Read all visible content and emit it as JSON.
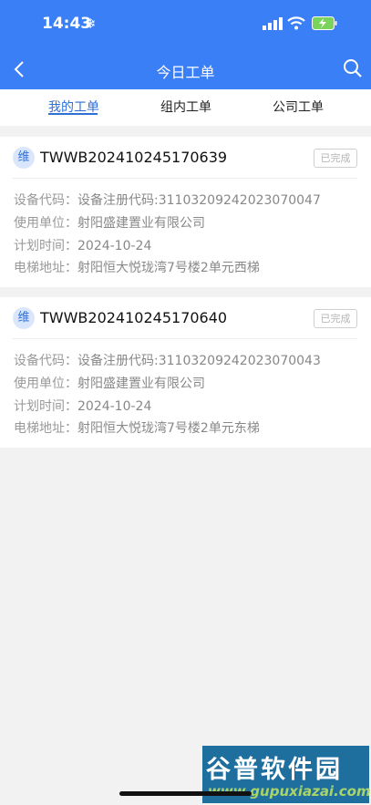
{
  "status_bar": {
    "time": "14:43",
    "weather_icon": "snowflake-icon"
  },
  "nav": {
    "title": "今日工单"
  },
  "tabs": [
    {
      "label": "我的工单",
      "active": true
    },
    {
      "label": "组内工单",
      "active": false
    },
    {
      "label": "公司工单",
      "active": false
    }
  ],
  "orders": [
    {
      "badge": "维",
      "number": "TWWB202410245170639",
      "status": "已完成",
      "fields": [
        {
          "label": "设备代码：",
          "value": "设备注册代码:31103209242023070047"
        },
        {
          "label": "使用单位：",
          "value": "射阳盛建置业有限公司"
        },
        {
          "label": "计划时间：",
          "value": "2024-10-24"
        },
        {
          "label": "电梯地址：",
          "value": "射阳恒大悦珑湾7号楼2单元西梯"
        }
      ]
    },
    {
      "badge": "维",
      "number": "TWWB202410245170640",
      "status": "已完成",
      "fields": [
        {
          "label": "设备代码：",
          "value": "设备注册代码:31103209242023070043"
        },
        {
          "label": "使用单位：",
          "value": "射阳盛建置业有限公司"
        },
        {
          "label": "计划时间：",
          "value": "2024-10-24"
        },
        {
          "label": "电梯地址：",
          "value": "射阳恒大悦珑湾7号楼2单元东梯"
        }
      ]
    }
  ],
  "watermark": {
    "main": "谷普软件园",
    "sub": "www.gupuxiazai.com"
  },
  "colors": {
    "primary": "#3a7ff6",
    "tab_active": "#2f6fd8"
  }
}
